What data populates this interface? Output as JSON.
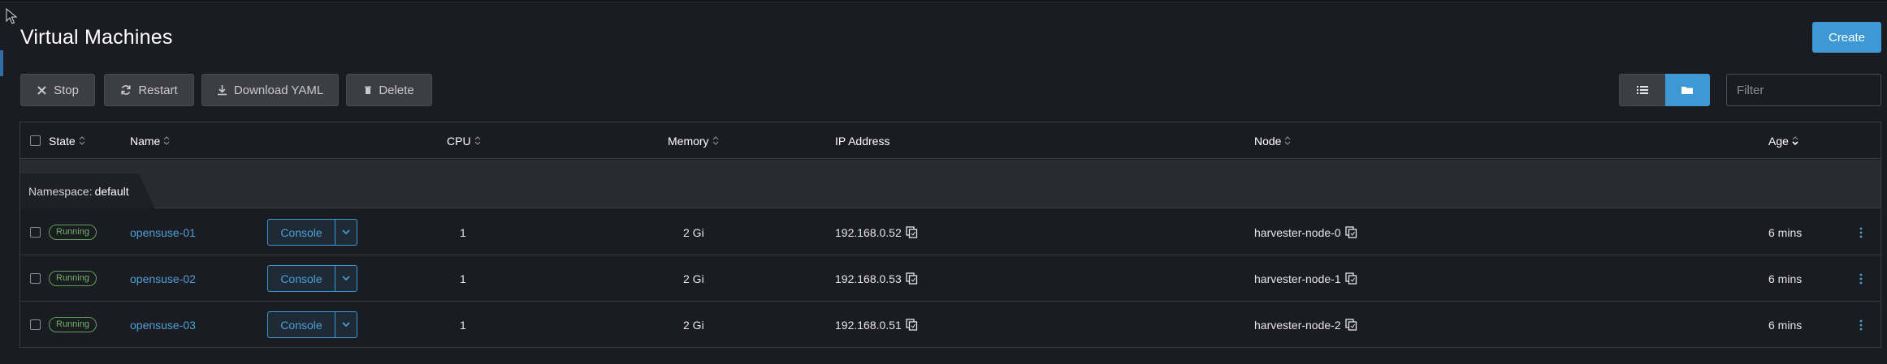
{
  "page": {
    "title": "Virtual Machines",
    "create_label": "Create"
  },
  "toolbar": {
    "stop_label": "Stop",
    "restart_label": "Restart",
    "download_label": "Download YAML",
    "delete_label": "Delete",
    "filter_placeholder": "Filter"
  },
  "table": {
    "columns": {
      "state": "State",
      "name": "Name",
      "cpu": "CPU",
      "memory": "Memory",
      "ip": "IP Address",
      "node": "Node",
      "age": "Age"
    },
    "group": {
      "prefix": "Namespace:",
      "value": "default"
    },
    "console_label": "Console",
    "rows": [
      {
        "state": "Running",
        "name": "opensuse-01",
        "cpu": "1",
        "memory": "2 Gi",
        "ip": "192.168.0.52",
        "node": "harvester-node-0",
        "age": "6 mins"
      },
      {
        "state": "Running",
        "name": "opensuse-02",
        "cpu": "1",
        "memory": "2 Gi",
        "ip": "192.168.0.53",
        "node": "harvester-node-1",
        "age": "6 mins"
      },
      {
        "state": "Running",
        "name": "opensuse-03",
        "cpu": "1",
        "memory": "2 Gi",
        "ip": "192.168.0.51",
        "node": "harvester-node-2",
        "age": "6 mins"
      }
    ]
  },
  "colors": {
    "accent": "#3d98d3",
    "link": "#4d9fd9",
    "running": "#6fb36a",
    "background": "#1b1c21"
  }
}
